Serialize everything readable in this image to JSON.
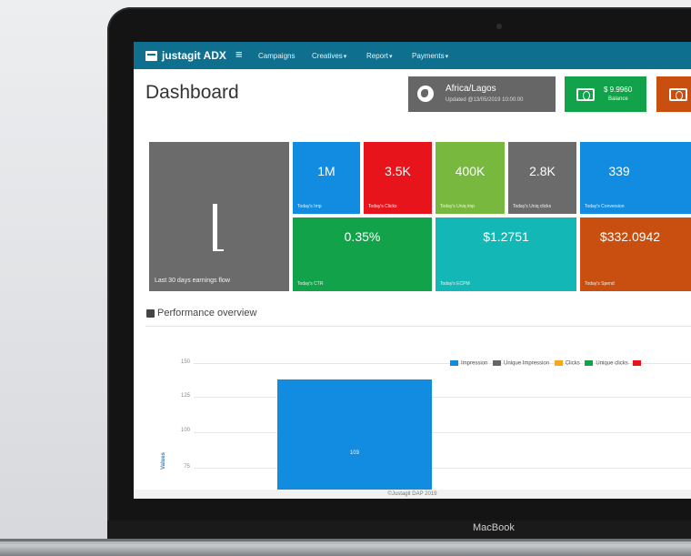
{
  "device": {
    "label": "MacBook"
  },
  "nav": {
    "brand": "justagit ADX",
    "menu_icon": "≡",
    "items": [
      "Campaigns",
      "Creatives",
      "Report",
      "Payments"
    ]
  },
  "header": {
    "title": "Dashboard",
    "timezone": {
      "name": "Africa/Lagos",
      "updated": "Updated @13/05/2019 10:00:00"
    },
    "balance": {
      "value": "$ 9.9960",
      "label": "Balance"
    }
  },
  "tiles": {
    "earnings_label": "Last 30 days earnings flow",
    "imp": {
      "value": "1M",
      "label": "Today's Imp"
    },
    "clicks": {
      "value": "3.5K",
      "label": "Today's Clicks"
    },
    "uniq_imp": {
      "value": "400K",
      "label": "Today's Uniq imp"
    },
    "uniq_clicks": {
      "value": "2.8K",
      "label": "Today's Uniq clicks"
    },
    "conversion": {
      "value": "339",
      "label": "Today's Conversion"
    },
    "ctr": {
      "value": "0.35%",
      "label": "Today's CTR"
    },
    "ecpm": {
      "value": "$1.2751",
      "label": "Today's ECPM"
    },
    "spend": {
      "value": "$332.0942",
      "label": "Today's Spend"
    }
  },
  "performance": {
    "title": "Performance overview"
  },
  "colors": {
    "navbar": "#0f6f8e",
    "impression": "#118ce0",
    "unique_impression": "#666666",
    "clicks": "#f5a623",
    "unique_clicks": "#12a34a",
    "red": "#e8141b"
  },
  "chart_data": {
    "type": "bar",
    "ylabel": "Values",
    "yticks": [
      "150",
      "125",
      "100",
      "75"
    ],
    "ylim": [
      62,
      150
    ],
    "legend": [
      "Impression",
      "Unique Impression",
      "Clicks",
      "Unique clicks"
    ],
    "series": [
      {
        "name": "Impression",
        "values": [
          138
        ],
        "data_label": "103"
      }
    ]
  },
  "footer": {
    "text": "©Justagit DAP 2019"
  }
}
